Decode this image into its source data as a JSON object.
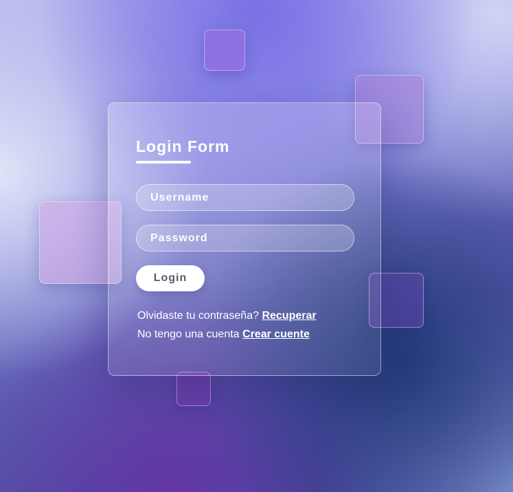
{
  "form": {
    "title": "Login Form",
    "username_placeholder": "Username",
    "password_placeholder": "Password",
    "login_label": "Login"
  },
  "links": {
    "forgot_text": "Olvidaste tu contraseña?",
    "forgot_link": "Recuperar",
    "no_account_text": "No tengo una cuenta",
    "create_link": "Crear cuente"
  },
  "colors": {
    "accent_dark": "#233a7a",
    "accent_purple": "#6436a6",
    "text": "#ffffff",
    "button_text": "#555a66"
  }
}
